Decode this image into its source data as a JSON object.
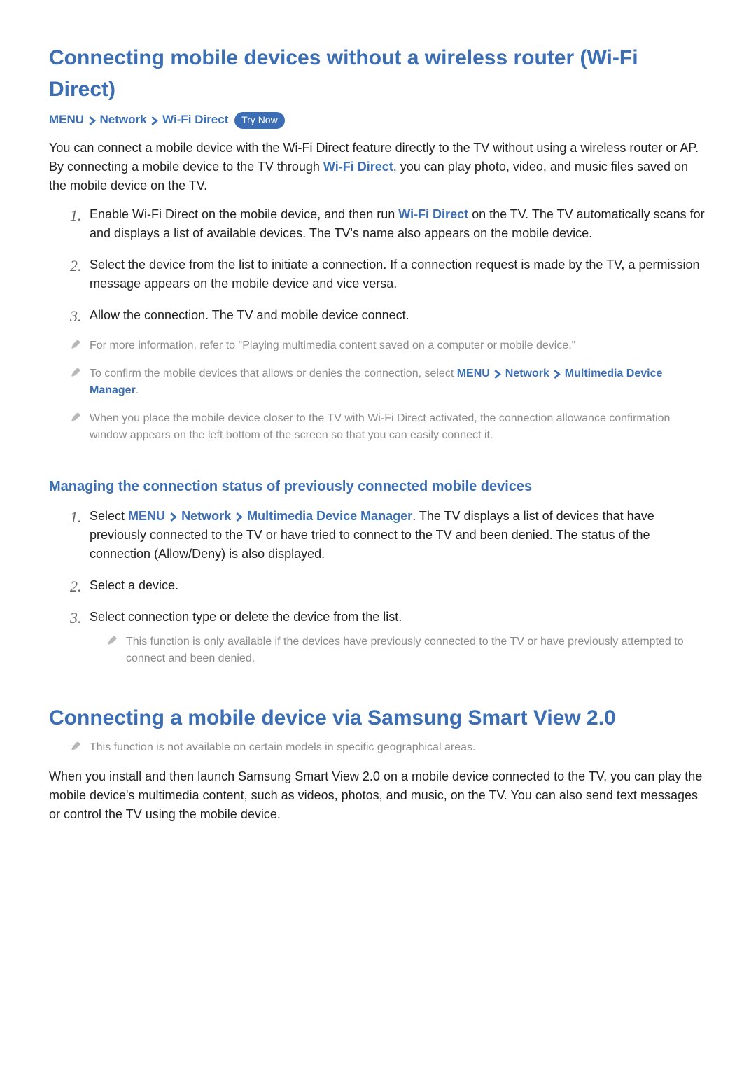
{
  "section1": {
    "title": "Connecting mobile devices without a wireless router (Wi-Fi Direct)",
    "bc_menu": "MENU",
    "bc_network": "Network",
    "bc_wifi": "Wi-Fi Direct",
    "try_now": "Try Now",
    "intro_a": "You can connect a mobile device with the Wi-Fi Direct feature directly to the TV without using a wireless router or AP. By connecting a mobile device to the TV through ",
    "intro_kw": "Wi-Fi Direct",
    "intro_b": ", you can play photo, video, and music files saved on the mobile device on the TV.",
    "steps": [
      {
        "n": "1.",
        "a": "Enable Wi-Fi Direct on the mobile device, and then run ",
        "kw": "Wi-Fi Direct",
        "b": " on the TV. The TV automatically scans for and displays a list of available devices. The TV's name also appears on the mobile device."
      },
      {
        "n": "2.",
        "a": "Select the device from the list to initiate a connection. If a connection request is made by the TV, a permission message appears on the mobile device and vice versa.",
        "kw": "",
        "b": ""
      },
      {
        "n": "3.",
        "a": "Allow the connection. The TV and mobile device connect.",
        "kw": "",
        "b": ""
      }
    ],
    "note1": "For more information, refer to \"Playing multimedia content saved on a computer or mobile device.\"",
    "note2_a": "To confirm the mobile devices that allows or denies the connection, select ",
    "note2_menu": "MENU",
    "note2_network": "Network",
    "note2_mdm": "Multimedia Device Manager",
    "note2_dot": ".",
    "note3": "When you place the mobile device closer to the TV with Wi-Fi Direct activated, the connection allowance confirmation window appears on the left bottom of the screen so that you can easily connect it."
  },
  "section2": {
    "title": "Managing the connection status of previously connected mobile devices",
    "steps": [
      {
        "n": "1.",
        "lead": "Select ",
        "menu": "MENU",
        "network": "Network",
        "mdm": "Multimedia Device Manager",
        "tail": ". The TV displays a list of devices that have previously connected to the TV or have tried to connect to the TV and been denied. The status of the connection (Allow/Deny) is also displayed."
      },
      {
        "n": "2.",
        "text": "Select a device."
      },
      {
        "n": "3.",
        "text": "Select connection type or delete the device from the list.",
        "inner_note": "This function is only available if the devices have previously connected to the TV or have previously attempted to connect and been denied."
      }
    ]
  },
  "section3": {
    "title": "Connecting a mobile device via Samsung Smart View 2.0",
    "note": "This function is not available on certain models in specific geographical areas.",
    "para": "When you install and then launch Samsung Smart View 2.0 on a mobile device connected to the TV, you can play the mobile device's multimedia content, such as videos, photos, and music, on the TV. You can also send text messages or control the TV using the mobile device."
  }
}
